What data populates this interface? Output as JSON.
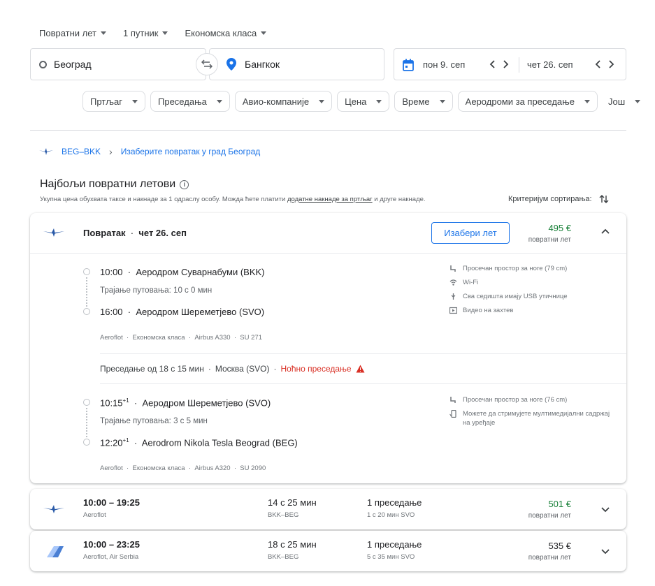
{
  "top": {
    "trip_type": "Повратни лет",
    "passengers": "1 путник",
    "cabin": "Економска класа"
  },
  "search": {
    "from": "Београд",
    "to": "Бангкок",
    "depart_date": "пон 9. сеп",
    "return_date": "чет 26. сеп"
  },
  "chips": [
    "Пртљаг",
    "Преседања",
    "Авио-компаније",
    "Цена",
    "Време",
    "Аеродроми за преседање",
    "Још"
  ],
  "breadcrumb": {
    "route": "BEG–BKK",
    "step": "Изаберите повратак у град Београд"
  },
  "heading": {
    "title": "Најбољи повратни летови",
    "sub_pre": "Укупна цена обухвата таксе и накнаде за 1 одраслу особу. Можда ћете платити ",
    "sub_link": "додатне накнаде за пртљаг",
    "sub_post": " и друге накнаде.",
    "sort_label": "Критеријум сортирања:"
  },
  "expanded": {
    "title": "Повратак",
    "date": "чет 26. сеп",
    "select_label": "Изабери лет",
    "price": "495 €",
    "price_label": "повратни лет",
    "seg1": {
      "dep_time": "10:00",
      "dep_airport": "Аеродром Суварнабуми (BKK)",
      "duration": "Трајање путовања: 10 с 0 мин",
      "arr_time": "16:00",
      "arr_airport": "Аеродром Шереметјево (SVO)",
      "meta": [
        "Aeroflot",
        "Економска класа",
        "Airbus A330",
        "SU 271"
      ],
      "amenities": [
        "Просечан простор за ноге (79 cm)",
        "Wi-Fi",
        "Сва седишта имају USB утичнице",
        "Видео на захтев"
      ]
    },
    "layover": {
      "text": "Преседање од 18 с 15 мин",
      "city": "Москва (SVO)",
      "warning": "Ноћно преседање"
    },
    "seg2": {
      "dep_time": "10:15",
      "dep_sup": "+1",
      "dep_airport": "Аеродром Шереметјево (SVO)",
      "duration": "Трајање путовања: 3 с 5 мин",
      "arr_time": "12:20",
      "arr_sup": "+1",
      "arr_airport": "Aerodrom Nikola Tesla Beograd (BEG)",
      "meta": [
        "Aeroflot",
        "Економска класа",
        "Airbus A320",
        "SU 2090"
      ],
      "amenities": [
        "Просечан простор за ноге (76 cm)",
        "Можете да стримујете мултимедијални садржај на уређаје"
      ]
    }
  },
  "results": [
    {
      "times": "10:00 – 19:25",
      "airline": "Aeroflot",
      "duration": "14 с 25 мин",
      "route": "BKK–BEG",
      "stops": "1 преседање",
      "stop_detail": "1 с 20 мин SVO",
      "price": "501 €",
      "price_label": "повратни лет"
    },
    {
      "times": "10:00 – 23:25",
      "airline": "Aeroflot, Air Serbia",
      "duration": "18 с 25 мин",
      "route": "BKK–BEG",
      "stops": "1 преседање",
      "stop_detail": "5 с 35 мин SVO",
      "price": "535 €",
      "price_label": "повратни лет"
    }
  ],
  "colors": {
    "accent": "#1a73e8",
    "price_green": "#188038",
    "warning_red": "#d93025"
  }
}
